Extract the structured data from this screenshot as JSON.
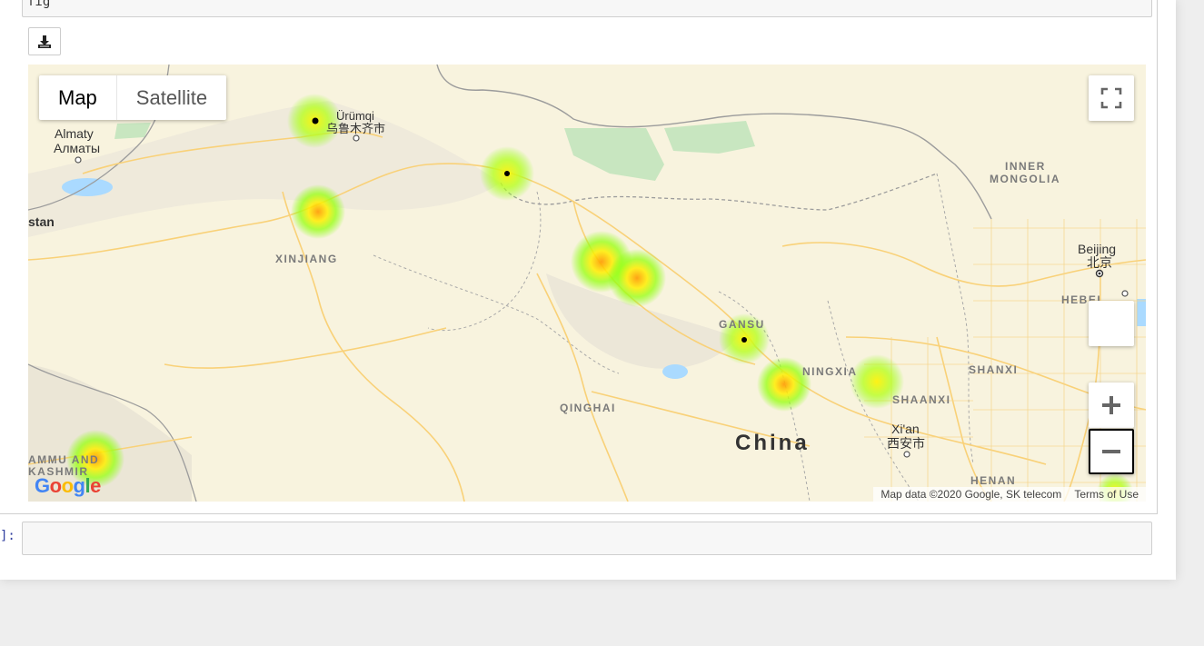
{
  "notebook": {
    "input_code": "fig",
    "next_prompt": "]:",
    "download_icon": "download-icon"
  },
  "map": {
    "map_type_buttons": [
      "Map",
      "Satellite"
    ],
    "active_map_type": "Map",
    "controls": {
      "fullscreen_icon": "fullscreen-icon",
      "zoom_in_icon": "plus-icon",
      "zoom_out_icon": "minus-icon"
    },
    "labels": {
      "almaty": "Almaty",
      "almaty_local": "Алматы",
      "urumqi": "Ürümqi",
      "urumqi_local": "乌鲁木齐市",
      "stan": "stan",
      "xinjiang": "XINJIANG",
      "inner_mongolia_1": "INNER",
      "inner_mongolia_2": "MONGOLIA",
      "beijing": "Beijing",
      "beijing_local": "北京",
      "hebei": "HEBEI",
      "gansu": "GANSU",
      "ningxia": "NINGXIA",
      "shanxi": "SHANXI",
      "shaanxi": "SHAANXI",
      "qinghai": "QINGHAI",
      "china": "China",
      "xian": "Xi'an",
      "xian_local": "西安市",
      "henan": "HENAN",
      "jammu_1": "AMMU AND",
      "jammu_2": "KASHMIR"
    },
    "google_logo": "Google",
    "attribution": "Map data ©2020 Google, SK telecom",
    "terms": "Terms of Use",
    "colors": {
      "land": "#f8f3de",
      "road": "#f9d178",
      "water": "#aadaff",
      "park": "#c8e6c0",
      "heat_low": "#7fff00",
      "heat_mid": "#ffff00",
      "heat_high": "#ff7f00"
    }
  }
}
